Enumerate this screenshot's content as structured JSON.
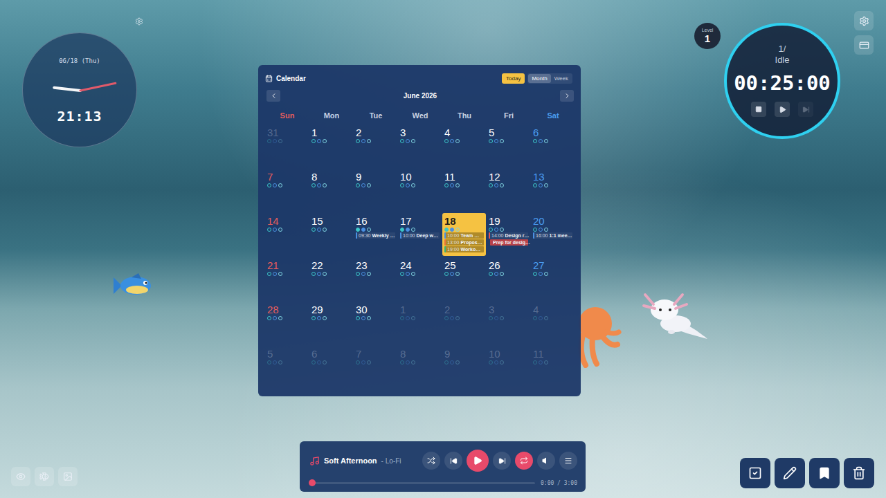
{
  "clock": {
    "date": "06/18 (Thu)",
    "time": "21:13"
  },
  "calendar": {
    "title": "Calendar",
    "today_button": "Today",
    "views": [
      {
        "label": "Month",
        "selected": true
      },
      {
        "label": "Week",
        "selected": false
      }
    ],
    "month": "June 2026",
    "weekdays": [
      "Sun",
      "Mon",
      "Tue",
      "Wed",
      "Thu",
      "Fri",
      "Sat"
    ],
    "weeks": [
      [
        {
          "day": "31",
          "muted": true,
          "today": false,
          "dots": [
            false,
            false,
            false
          ],
          "events": []
        },
        {
          "day": "1",
          "muted": false,
          "today": false,
          "dots": [
            false,
            false,
            false
          ],
          "events": []
        },
        {
          "day": "2",
          "muted": false,
          "today": false,
          "dots": [
            false,
            false,
            false
          ],
          "events": []
        },
        {
          "day": "3",
          "muted": false,
          "today": false,
          "dots": [
            false,
            false,
            false
          ],
          "events": []
        },
        {
          "day": "4",
          "muted": false,
          "today": false,
          "dots": [
            false,
            false,
            false
          ],
          "events": []
        },
        {
          "day": "5",
          "muted": false,
          "today": false,
          "dots": [
            false,
            false,
            false
          ],
          "events": []
        },
        {
          "day": "6",
          "muted": false,
          "today": false,
          "dots": [
            false,
            false,
            false
          ],
          "events": []
        }
      ],
      [
        {
          "day": "7",
          "muted": false,
          "today": false,
          "dots": [
            false,
            false,
            false
          ],
          "events": []
        },
        {
          "day": "8",
          "muted": false,
          "today": false,
          "dots": [
            false,
            false,
            false
          ],
          "events": []
        },
        {
          "day": "9",
          "muted": false,
          "today": false,
          "dots": [
            false,
            false,
            false
          ],
          "events": []
        },
        {
          "day": "10",
          "muted": false,
          "today": false,
          "dots": [
            false,
            false,
            false
          ],
          "events": []
        },
        {
          "day": "11",
          "muted": false,
          "today": false,
          "dots": [
            false,
            false,
            false
          ],
          "events": []
        },
        {
          "day": "12",
          "muted": false,
          "today": false,
          "dots": [
            false,
            false,
            false
          ],
          "events": []
        },
        {
          "day": "13",
          "muted": false,
          "today": false,
          "dots": [
            false,
            false,
            false
          ],
          "events": []
        }
      ],
      [
        {
          "day": "14",
          "muted": false,
          "today": false,
          "dots": [
            false,
            false,
            false
          ],
          "events": []
        },
        {
          "day": "15",
          "muted": false,
          "today": false,
          "dots": [
            false,
            false,
            false
          ],
          "events": []
        },
        {
          "day": "16",
          "muted": false,
          "today": false,
          "dots": [
            true,
            true,
            false
          ],
          "events": [
            {
              "kind": "timed",
              "time": "09:30",
              "title": "Weekly …",
              "color": "#4a90e2"
            }
          ]
        },
        {
          "day": "17",
          "muted": false,
          "today": false,
          "dots": [
            true,
            true,
            false
          ],
          "events": [
            {
              "kind": "timed",
              "time": "10:00",
              "title": "Deep w…",
              "color": "#4a90e2"
            }
          ]
        },
        {
          "day": "18",
          "muted": false,
          "today": true,
          "dots": [
            true,
            true,
            false
          ],
          "events": [
            {
              "kind": "timed",
              "time": "10:00",
              "title": "Team …",
              "color": "#4a90e2"
            },
            {
              "kind": "timed",
              "time": "13:00",
              "title": "Propos…",
              "color": "#e8743b"
            },
            {
              "kind": "timed",
              "time": "19:00",
              "title": "Worko…",
              "color": "#3bb273"
            }
          ]
        },
        {
          "day": "19",
          "muted": false,
          "today": false,
          "dots": [
            false,
            false,
            false
          ],
          "events": [
            {
              "kind": "timed",
              "time": "14:00",
              "title": "Design r…",
              "color": "#e05656"
            },
            {
              "kind": "allday",
              "time": "",
              "title": "Prep for desig…",
              "color": "#b8434a"
            }
          ]
        },
        {
          "day": "20",
          "muted": false,
          "today": false,
          "dots": [
            false,
            false,
            false
          ],
          "events": [
            {
              "kind": "timed",
              "time": "16:00",
              "title": "1:1 mee…",
              "color": "#4a90e2"
            }
          ]
        }
      ],
      [
        {
          "day": "21",
          "muted": false,
          "today": false,
          "dots": [
            false,
            false,
            false
          ],
          "events": []
        },
        {
          "day": "22",
          "muted": false,
          "today": false,
          "dots": [
            false,
            false,
            false
          ],
          "events": []
        },
        {
          "day": "23",
          "muted": false,
          "today": false,
          "dots": [
            false,
            false,
            false
          ],
          "events": []
        },
        {
          "day": "24",
          "muted": false,
          "today": false,
          "dots": [
            false,
            false,
            false
          ],
          "events": []
        },
        {
          "day": "25",
          "muted": false,
          "today": false,
          "dots": [
            false,
            false,
            false
          ],
          "events": []
        },
        {
          "day": "26",
          "muted": false,
          "today": false,
          "dots": [
            false,
            false,
            false
          ],
          "events": []
        },
        {
          "day": "27",
          "muted": false,
          "today": false,
          "dots": [
            false,
            false,
            false
          ],
          "events": []
        }
      ],
      [
        {
          "day": "28",
          "muted": false,
          "today": false,
          "dots": [
            false,
            false,
            false
          ],
          "events": []
        },
        {
          "day": "29",
          "muted": false,
          "today": false,
          "dots": [
            false,
            false,
            false
          ],
          "events": []
        },
        {
          "day": "30",
          "muted": false,
          "today": false,
          "dots": [
            false,
            false,
            false
          ],
          "events": []
        },
        {
          "day": "1",
          "muted": true,
          "today": false,
          "dots": [
            false,
            false,
            false
          ],
          "events": []
        },
        {
          "day": "2",
          "muted": true,
          "today": false,
          "dots": [
            false,
            false,
            false
          ],
          "events": []
        },
        {
          "day": "3",
          "muted": true,
          "today": false,
          "dots": [
            false,
            false,
            false
          ],
          "events": []
        },
        {
          "day": "4",
          "muted": true,
          "today": false,
          "dots": [
            false,
            false,
            false
          ],
          "events": []
        }
      ],
      [
        {
          "day": "5",
          "muted": true,
          "today": false,
          "dots": [
            false,
            false,
            false
          ],
          "events": []
        },
        {
          "day": "6",
          "muted": true,
          "today": false,
          "dots": [
            false,
            false,
            false
          ],
          "events": []
        },
        {
          "day": "7",
          "muted": true,
          "today": false,
          "dots": [
            false,
            false,
            false
          ],
          "events": []
        },
        {
          "day": "8",
          "muted": true,
          "today": false,
          "dots": [
            false,
            false,
            false
          ],
          "events": []
        },
        {
          "day": "9",
          "muted": true,
          "today": false,
          "dots": [
            false,
            false,
            false
          ],
          "events": []
        },
        {
          "day": "10",
          "muted": true,
          "today": false,
          "dots": [
            false,
            false,
            false
          ],
          "events": []
        },
        {
          "day": "11",
          "muted": true,
          "today": false,
          "dots": [
            false,
            false,
            false
          ],
          "events": []
        }
      ]
    ]
  },
  "timer": {
    "level_label": "Level",
    "level": "1",
    "count": "1/",
    "status": "Idle",
    "time": "00:25:00",
    "controls": [
      {
        "kind": "stop",
        "disabled": false
      },
      {
        "kind": "play",
        "disabled": false
      },
      {
        "kind": "skip",
        "disabled": true
      }
    ]
  },
  "side_buttons": [
    {
      "kind": "settings"
    },
    {
      "kind": "card"
    }
  ],
  "player": {
    "title": "Soft Afternoon",
    "subtitle": "- Lo-Fi",
    "playing": false,
    "level": 0,
    "time": "0:00 / 3:00",
    "controls": [
      {
        "kind": "shuffle",
        "on": false
      },
      {
        "kind": "prev",
        "on": false
      },
      {
        "kind": "play",
        "on": false
      },
      {
        "kind": "next",
        "on": false
      },
      {
        "kind": "repeat",
        "on": true
      },
      {
        "kind": "volume",
        "on": false
      },
      {
        "kind": "queue",
        "on": false
      }
    ]
  },
  "view_tools": [
    {
      "kind": "eye"
    },
    {
      "kind": "fish"
    },
    {
      "kind": "image"
    }
  ],
  "action_tools": [
    {
      "kind": "tasks"
    },
    {
      "kind": "edit"
    },
    {
      "kind": "bookmark"
    },
    {
      "kind": "delete"
    }
  ]
}
